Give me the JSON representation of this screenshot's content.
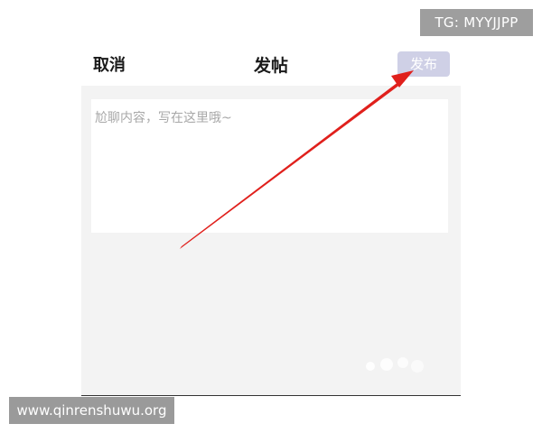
{
  "header": {
    "cancel_label": "取消",
    "title": "发帖",
    "publish_label": "发布"
  },
  "compose": {
    "placeholder": "尬聊内容，写在这里哦~",
    "value": ""
  },
  "watermarks": {
    "top_right": "TG: MYYJJPP",
    "bottom_left": "www.qinrenshuwu.org"
  },
  "colors": {
    "publish_button_bg": "#cfd0e6",
    "compose_background": "#f3f3f3",
    "annotation_arrow": "#e0201c"
  },
  "annotation": {
    "arrow_target": "publish-button"
  }
}
